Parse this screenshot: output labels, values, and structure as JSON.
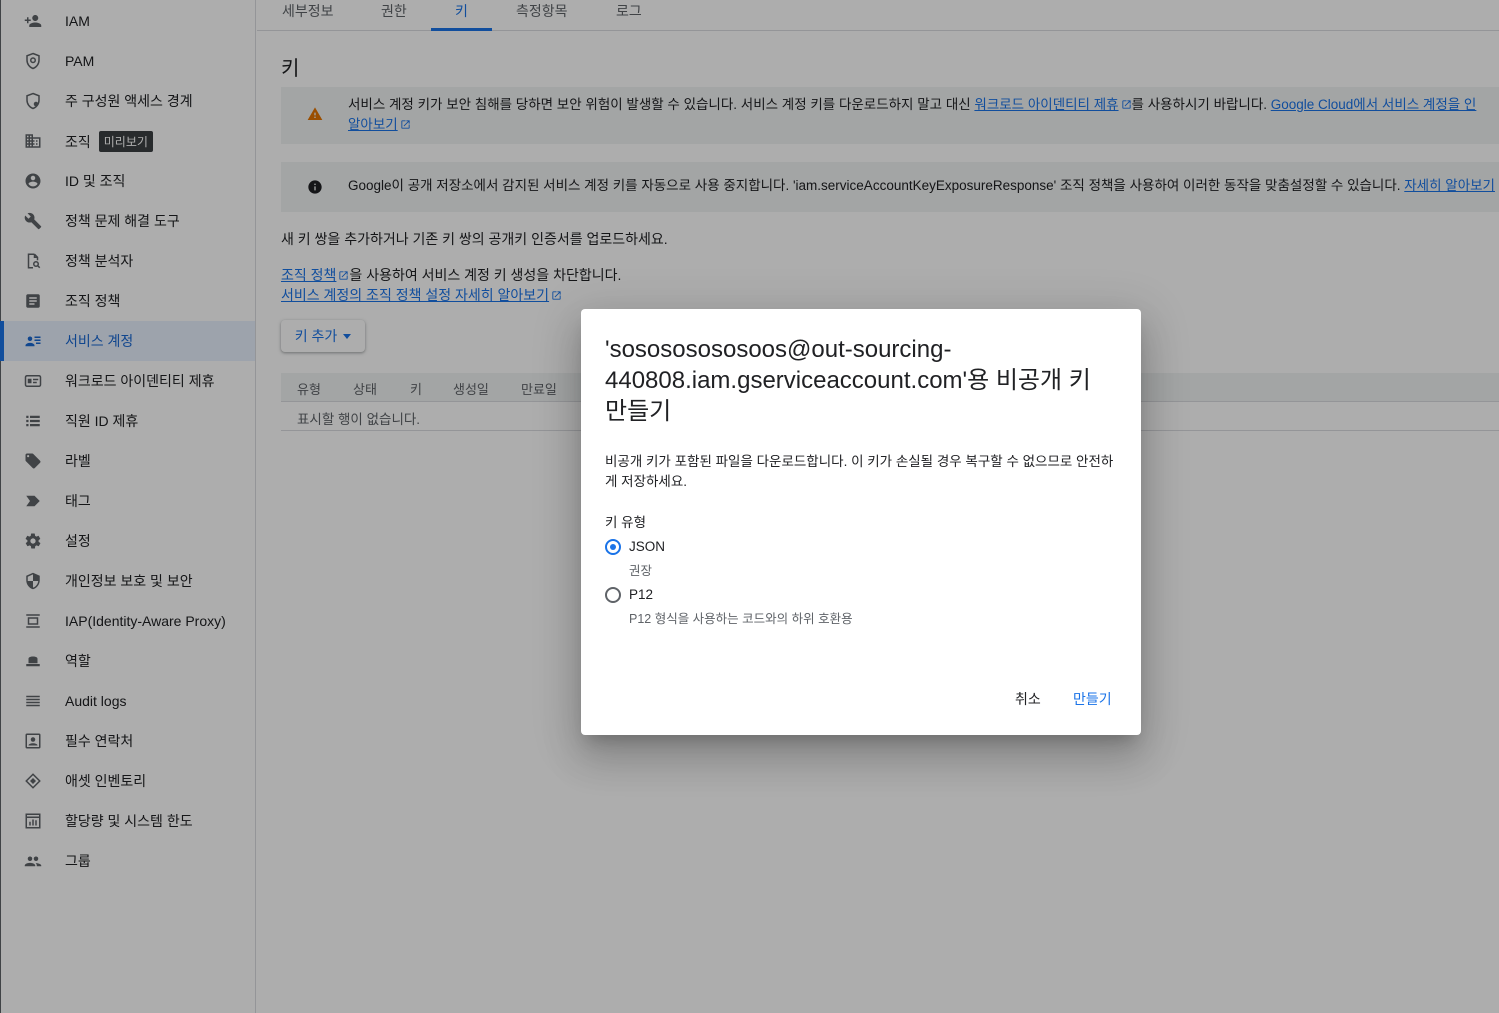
{
  "sidebar": {
    "items": [
      {
        "label": "IAM",
        "icon": "person-add-icon"
      },
      {
        "label": "PAM",
        "icon": "shield-clock-icon"
      },
      {
        "label": "주 구성원 액세스 경계",
        "icon": "policy-boundary-icon"
      },
      {
        "label": "조직",
        "icon": "building-icon",
        "badge": "미리보기"
      },
      {
        "label": "ID 및 조직",
        "icon": "account-circle-icon"
      },
      {
        "label": "정책 문제 해결 도구",
        "icon": "wrench-icon"
      },
      {
        "label": "정책 분석자",
        "icon": "document-search-icon"
      },
      {
        "label": "조직 정책",
        "icon": "article-icon"
      },
      {
        "label": "서비스 계정",
        "icon": "service-account-icon",
        "active": true
      },
      {
        "label": "워크로드 아이덴티티 제휴",
        "icon": "id-card-icon"
      },
      {
        "label": "직원 ID 제휴",
        "icon": "list-icon"
      },
      {
        "label": "라벨",
        "icon": "label-tag-icon"
      },
      {
        "label": "태그",
        "icon": "tag-arrow-icon"
      },
      {
        "label": "설정",
        "icon": "gear-icon"
      },
      {
        "label": "개인정보 보호 및 보안",
        "icon": "security-shield-icon"
      },
      {
        "label": "IAP(Identity-Aware Proxy)",
        "icon": "proxy-icon"
      },
      {
        "label": "역할",
        "icon": "hat-icon"
      },
      {
        "label": "Audit logs",
        "icon": "lines-icon"
      },
      {
        "label": "필수 연락처",
        "icon": "contact-card-icon"
      },
      {
        "label": "애셋 인벤토리",
        "icon": "diamond-layers-icon"
      },
      {
        "label": "할당량 및 시스템 한도",
        "icon": "quota-icon"
      },
      {
        "label": "그룹",
        "icon": "group-icon"
      }
    ]
  },
  "tabs": [
    "세부정보",
    "권한",
    "키",
    "측정항목",
    "로그"
  ],
  "active_tab": "키",
  "page": {
    "title": "키",
    "warning": {
      "text_before": "서비스 계정 키가 보안 침해를 당하면 보안 위험이 발생할 수 있습니다. 서비스 계정 키를 다운로드하지 말고 대신 ",
      "link1": "워크로드 아이덴티티 제휴",
      "text_middle": "를 사용하시기 바랍니다. ",
      "link2": "Google Cloud에서 서비스 계정을 인",
      "link3": "알아보기"
    },
    "info": {
      "text": "Google이 공개 저장소에서 감지된 서비스 계정 키를 자동으로 사용 중지합니다. 'iam.serviceAccountKeyExposureResponse' 조직 정책을 사용하여 이러한 동작을 맞춤설정할 수 있습니다. ",
      "link": "자세히 알아보기"
    },
    "add_pair_text": "새 키 쌍을 추가하거나 기존 키 쌍의 공개키 인증서를 업로드하세요.",
    "org_policy_link": "조직 정책",
    "org_policy_text": "을 사용하여 서비스 계정 키 생성을 차단합니다.",
    "learn_more_link": "서비스 계정의 조직 정책 설정 자세히 알아보기",
    "add_key_button": "키 추가",
    "table_headers": [
      "유형",
      "상태",
      "키",
      "생성일",
      "만료일"
    ],
    "empty_text": "표시할 행이 없습니다."
  },
  "dialog": {
    "title": "'sosososososoos@out-sourcing-440808.iam.gserviceaccount.com'용 비공개 키 만들기",
    "description": "비공개 키가 포함된 파일을 다운로드합니다. 이 키가 손실될 경우 복구할 수 없으므로 안전하게 저장하세요.",
    "key_type_label": "키 유형",
    "options": [
      {
        "label": "JSON",
        "sub": "권장",
        "checked": true
      },
      {
        "label": "P12",
        "sub": "P12 형식을 사용하는 코드와의 하위 호환용",
        "checked": false
      }
    ],
    "cancel": "취소",
    "create": "만들기"
  },
  "colors": {
    "accent": "#1a73e8",
    "warning": "#e37400",
    "overlay": "rgba(0,0,0,0.32)"
  }
}
